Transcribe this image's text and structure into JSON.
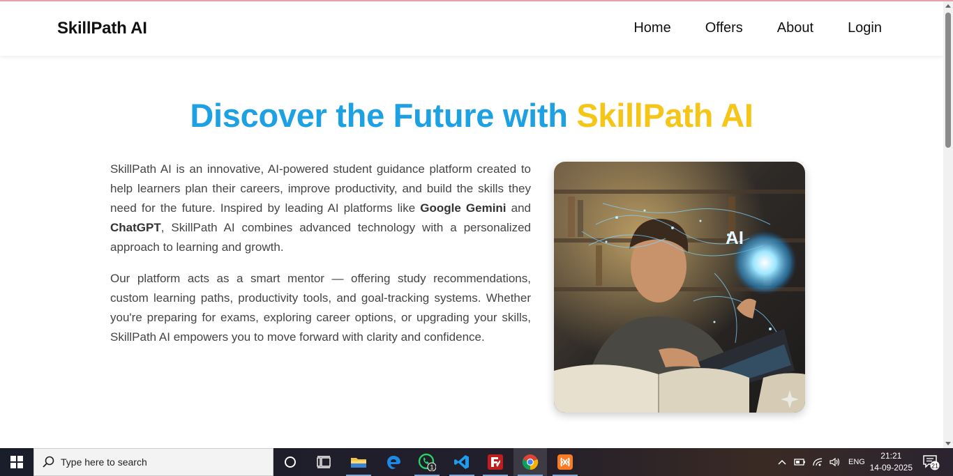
{
  "nav": {
    "brand": "SkillPath AI",
    "links": [
      "Home",
      "Offers",
      "About",
      "Login"
    ]
  },
  "hero": {
    "title_part1": "Discover the Future with ",
    "title_part2": "SkillPath AI",
    "p1_a": "SkillPath AI is an innovative, AI-powered student guidance platform created to help learners plan their careers, improve productivity, and build the skills they need for the future. Inspired by leading AI platforms like ",
    "p1_b1": "Google Gemini",
    "p1_and": " and ",
    "p1_b2": "ChatGPT",
    "p1_c": ", SkillPath AI combines advanced technology with a personalized approach to learning and growth.",
    "p2": "Our platform acts as a smart mentor — offering study recommendations, custom learning paths, productivity tools, and goal-tracking systems. Whether you're preparing for exams, exploring career options, or upgrading your skills, SkillPath AI empowers you to move forward with clarity and confidence.",
    "image_label": "AI"
  },
  "colors": {
    "title_blue": "#1da1e2",
    "title_yellow": "#f5c518"
  },
  "taskbar": {
    "search_placeholder": "Type here to search",
    "whatsapp_badge": "1",
    "language": "ENG",
    "time": "21:21",
    "date": "14-09-2025",
    "notification_count": "21",
    "icons": [
      "windows-start-icon",
      "search-icon",
      "cortana-icon",
      "task-view-icon",
      "file-explorer-icon",
      "edge-icon",
      "whatsapp-icon",
      "vscode-icon",
      "filezilla-icon",
      "chrome-icon",
      "xampp-icon"
    ]
  }
}
